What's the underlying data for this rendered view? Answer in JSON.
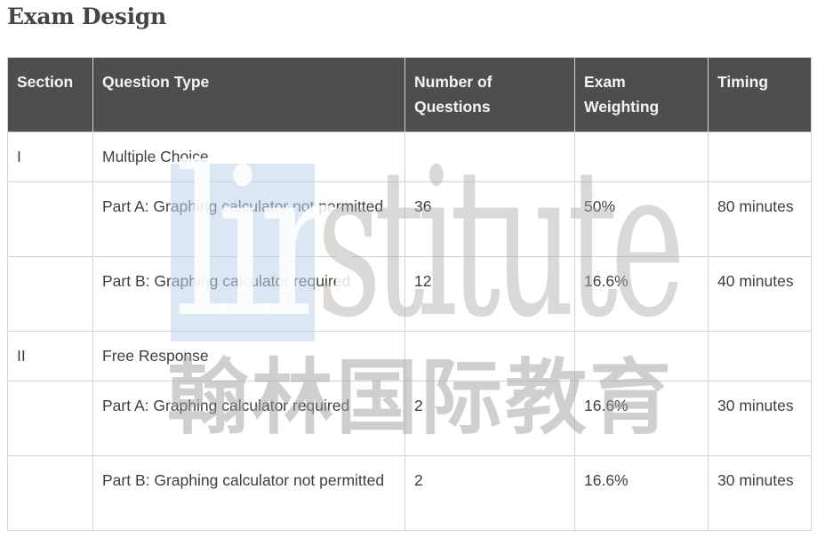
{
  "page": {
    "title": "Exam Design"
  },
  "table": {
    "headers": [
      "Section",
      "Question Type",
      "Number of Questions",
      "Exam Weighting",
      "Timing"
    ],
    "rows": [
      {
        "section": "I",
        "question_type": "Multiple Choice",
        "number_of_questions": "",
        "exam_weighting": "",
        "timing": ""
      },
      {
        "section": "",
        "question_type": "Part A: Graphing calculator not permitted",
        "number_of_questions": "36",
        "exam_weighting": "50%",
        "timing": "80 minutes"
      },
      {
        "section": "",
        "question_type": "Part B: Graphing calculator required",
        "number_of_questions": "12",
        "exam_weighting": "16.6%",
        "timing": "40 minutes"
      },
      {
        "section": "II",
        "question_type": "Free Response",
        "number_of_questions": "",
        "exam_weighting": "",
        "timing": ""
      },
      {
        "section": "",
        "question_type": "Part A: Graphing calculator required",
        "number_of_questions": "2",
        "exam_weighting": "16.6%",
        "timing": "30 minutes"
      },
      {
        "section": "",
        "question_type": "Part B: Graphing calculator not permitted",
        "number_of_questions": "2",
        "exam_weighting": "16.6%",
        "timing": "30 minutes"
      }
    ]
  },
  "watermark": {
    "brand_highlight": "lin",
    "brand_rest": "stitute",
    "chinese_text": "翰林国际教育"
  },
  "colors": {
    "header_bg": "#4e4e4e",
    "header_text": "#f4f4f4",
    "body_text": "#3f3f3f",
    "border": "#d4d4d4",
    "title_text": "#454545"
  }
}
